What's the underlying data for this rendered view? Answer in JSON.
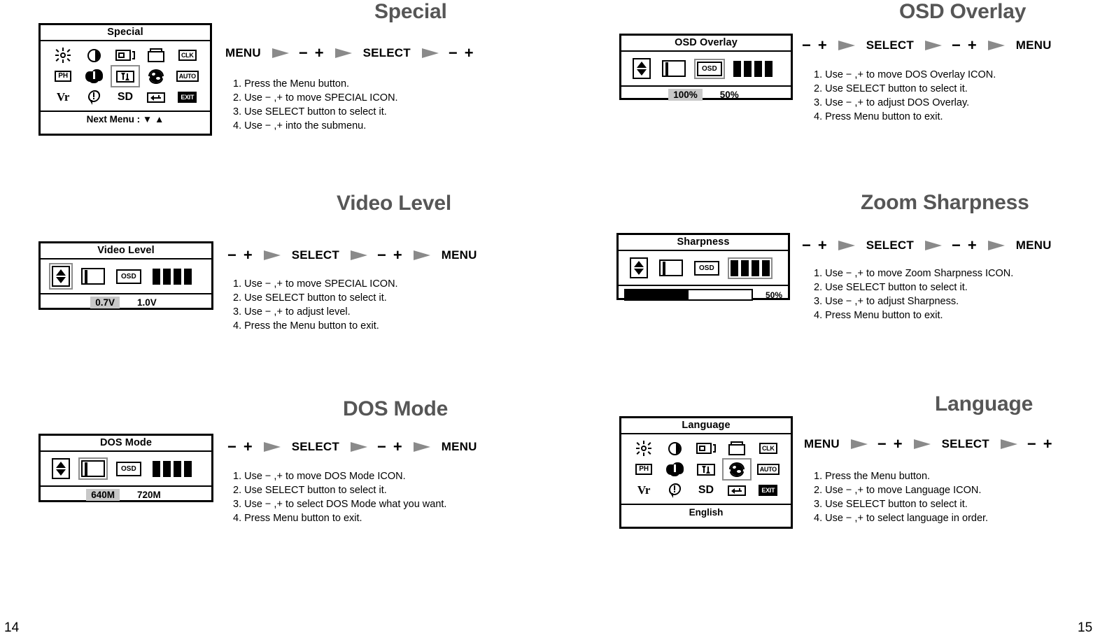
{
  "document": {
    "left_page_number": "14",
    "right_page_number": "15"
  },
  "colors": {
    "title_gray": "#565656",
    "arrow_gray": "#8a8a8a",
    "highlight_gray": "#c8c8c8",
    "selection_outline": "#8c8c8c"
  },
  "icon_grid_labels": {
    "brightness": "brightness-sun-icon",
    "contrast": "contrast-half-circle-icon",
    "h_position": "h-size-icon",
    "v_position": "v-size-icon",
    "clk": "CLK",
    "ph": "PH",
    "moire": "moire-icon",
    "pincushion": "pincushion-icon",
    "globe": "globe-language-icon",
    "auto": "AUTO",
    "vr": "Vr",
    "exclamation": "exclamation-bubble-icon",
    "sd": "SD",
    "return": "return-arrow-icon",
    "exit": "EXIT"
  },
  "sections": [
    {
      "id": "special",
      "title": "Special",
      "panel": {
        "header": "Special",
        "type": "icon-grid",
        "footer": "Next Menu : ▼ ▲",
        "selected_icon": {
          "row": 2,
          "col": 3,
          "name": "pincushion-icon"
        }
      },
      "sequence": [
        "MENU",
        "arrow",
        "−",
        "+",
        "arrow",
        "SELECT",
        "arrow",
        "−",
        "+"
      ],
      "steps": [
        "1. Press the Menu button.",
        "2. Use − ,+ to move SPECIAL ICON.",
        "3. Use SELECT button to select it.",
        "4. Use − ,+ into the submenu."
      ]
    },
    {
      "id": "video-level",
      "title": "Video Level",
      "panel": {
        "header": "Video Level",
        "type": "sub-row",
        "selected_icon": {
          "index": 0,
          "name": "up-down-arrow-icon"
        },
        "values": [
          {
            "label": "0.7V",
            "selected": true
          },
          {
            "label": "1.0V",
            "selected": false
          }
        ]
      },
      "sequence": [
        "−",
        "+",
        "arrow",
        "SELECT",
        "arrow",
        "−",
        "+",
        "arrow",
        "MENU"
      ],
      "steps": [
        "1. Use  − ,+ to move SPECIAL ICON.",
        "2. Use SELECT button to select it.",
        "3. Use  − ,+ to adjust level.",
        "4. Press the Menu button to exit."
      ]
    },
    {
      "id": "dos-mode",
      "title": "DOS Mode",
      "panel": {
        "header": "DOS Mode",
        "type": "sub-row",
        "selected_icon": {
          "index": 1,
          "name": "screen-icon"
        },
        "values": [
          {
            "label": "640M",
            "selected": true
          },
          {
            "label": "720M",
            "selected": false
          }
        ]
      },
      "sequence": [
        "−",
        "+",
        "arrow",
        "SELECT",
        "arrow",
        "−",
        "+",
        "arrow",
        "MENU"
      ],
      "steps": [
        "1. Use  − ,+ to move DOS Mode ICON.",
        "2. Use SELECT button to select it.",
        "3. Use  − ,+ to select DOS Mode what you want.",
        "4. Press Menu button to exit."
      ]
    },
    {
      "id": "osd-overlay",
      "title": "OSD Overlay",
      "panel": {
        "header": "OSD Overlay",
        "type": "sub-row",
        "selected_icon": {
          "index": 2,
          "name": "osd-label-icon"
        },
        "values": [
          {
            "label": "100%",
            "selected": true
          },
          {
            "label": "50%",
            "selected": false
          }
        ]
      },
      "sequence": [
        "−",
        "+",
        "arrow",
        "SELECT",
        "arrow",
        "−",
        "+",
        "arrow",
        "MENU"
      ],
      "steps": [
        "1. Use  − ,+ to move DOS Overlay ICON.",
        "2. Use SELECT button to select it.",
        "3. Use  − ,+ to adjust DOS Overlay.",
        "4. Press Menu button to exit."
      ]
    },
    {
      "id": "zoom-sharpness",
      "title": "Zoom Sharpness",
      "panel": {
        "header": "Sharpness",
        "type": "sub-row-slider",
        "selected_icon": {
          "index": 3,
          "name": "sharpness-bars-icon"
        },
        "slider": {
          "percent_label": "50%",
          "percent_value": 50
        }
      },
      "sequence": [
        "−",
        "+",
        "arrow",
        "SELECT",
        "arrow",
        "−",
        "+",
        "arrow",
        "MENU"
      ],
      "steps": [
        "1. Use  − ,+ to move Zoom Sharpness ICON.",
        "2. Use SELECT button to select it.",
        "3. Use  − ,+ to adjust Sharpness.",
        "4. Press Menu button to exit."
      ]
    },
    {
      "id": "language",
      "title": "Language",
      "panel": {
        "header": "Language",
        "type": "icon-grid",
        "footer": "English",
        "selected_icon": {
          "row": 2,
          "col": 4,
          "name": "globe-language-icon"
        }
      },
      "sequence": [
        "MENU",
        "arrow",
        "−",
        "+",
        "arrow",
        "SELECT",
        "arrow",
        "−",
        "+"
      ],
      "steps": [
        "1. Press the Menu button.",
        "2. Use  − ,+ to move Language ICON.",
        "3. Use SELECT button to select it.",
        "4. Use  − ,+ to select language in order."
      ]
    }
  ]
}
